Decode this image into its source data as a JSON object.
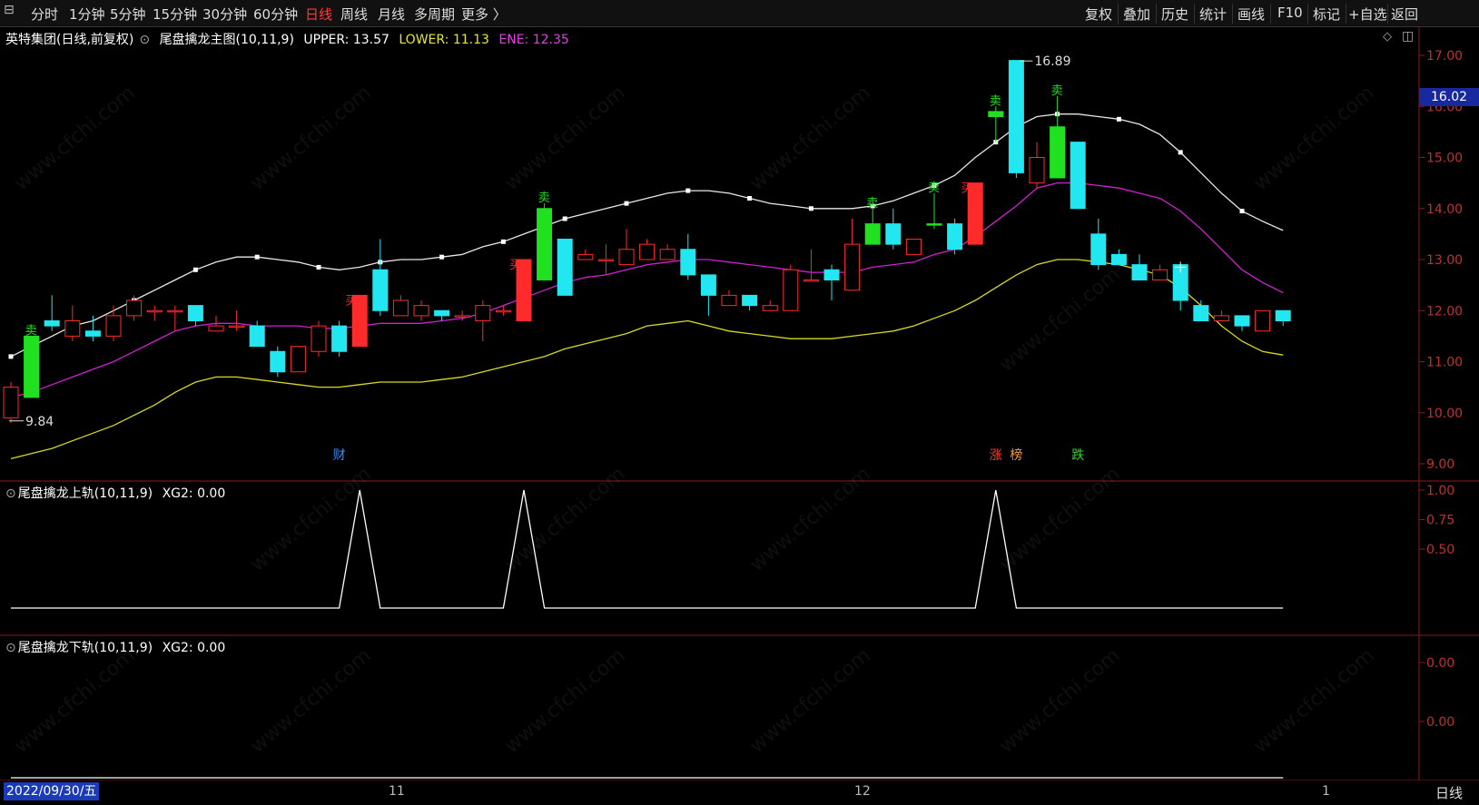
{
  "toolbar": {
    "tabs": [
      "分时",
      "1分钟",
      "5分钟",
      "15分钟",
      "30分钟",
      "60分钟",
      "日线",
      "周线",
      "月线",
      "多周期",
      "更多 〉"
    ],
    "active_tab": "日线",
    "right_buttons": [
      "复权",
      "叠加",
      "历史",
      "统计",
      "画线",
      "F10",
      "标记",
      "+自选",
      "返回"
    ]
  },
  "main_legend": {
    "stock": "英特集团(日线,前复权)",
    "indicator": "尾盘擒龙主图(10,11,9)",
    "upper": "UPPER: 13.57",
    "lower": "LOWER: 11.13",
    "ene": "ENE: 12.35"
  },
  "sub1_legend": {
    "name": "尾盘擒龙上轨(10,11,9)",
    "value": "XG2: 0.00"
  },
  "sub2_legend": {
    "name": "尾盘擒龙下轨(10,11,9)",
    "value": "XG2: 0.00"
  },
  "price_axis": [
    "17.00",
    "16.00",
    "15.00",
    "14.00",
    "13.00",
    "12.00",
    "11.00",
    "10.00",
    "9.00"
  ],
  "current_price": "16.02",
  "sub1_axis": [
    "1.00",
    "0.75",
    "0.50"
  ],
  "sub2_axis": [
    "0.00",
    "0.00"
  ],
  "annotations": {
    "high": "16.89",
    "low": "9.84"
  },
  "events": {
    "cai": "财",
    "zhang": "涨",
    "bang": "榜",
    "die": "跌"
  },
  "signals": {
    "buy": "买",
    "sell": "卖"
  },
  "x_labels": {
    "nov": "11",
    "dec": "12",
    "jan": "1"
  },
  "date_chip": "2022/09/30/五",
  "period": "日线",
  "watermark": "www.cfchi.com",
  "colors": {
    "up": "#ff2a2a",
    "down": "#22e6f0",
    "bull_signal": "#20e020",
    "upper": "#e8e8e8",
    "ene": "#d020d0",
    "lower": "#d8d820"
  },
  "chart_data": {
    "type": "candlestick",
    "ylim": [
      9.0,
      17.2
    ],
    "candles": [
      {
        "o": 9.9,
        "h": 10.6,
        "l": 9.8,
        "c": 10.5
      },
      {
        "o": 11.5,
        "h": 11.5,
        "l": 10.3,
        "c": 10.3,
        "sig": "bull"
      },
      {
        "o": 11.8,
        "h": 12.3,
        "l": 11.6,
        "c": 11.7
      },
      {
        "o": 11.5,
        "h": 12.1,
        "l": 11.4,
        "c": 11.8
      },
      {
        "o": 11.6,
        "h": 11.9,
        "l": 11.4,
        "c": 11.5
      },
      {
        "o": 11.5,
        "h": 12.1,
        "l": 11.4,
        "c": 11.9
      },
      {
        "o": 11.9,
        "h": 12.3,
        "l": 11.8,
        "c": 12.2
      },
      {
        "o": 12.0,
        "h": 12.1,
        "l": 11.8,
        "c": 12.0
      },
      {
        "o": 12.0,
        "h": 12.1,
        "l": 11.6,
        "c": 12.0
      },
      {
        "o": 12.1,
        "h": 12.1,
        "l": 11.7,
        "c": 11.8
      },
      {
        "o": 11.6,
        "h": 11.9,
        "l": 11.6,
        "c": 11.7
      },
      {
        "o": 11.7,
        "h": 12.0,
        "l": 11.6,
        "c": 11.7
      },
      {
        "o": 11.7,
        "h": 11.8,
        "l": 11.3,
        "c": 11.3
      },
      {
        "o": 11.2,
        "h": 11.3,
        "l": 10.7,
        "c": 10.8
      },
      {
        "o": 10.8,
        "h": 11.3,
        "l": 10.8,
        "c": 11.3
      },
      {
        "o": 11.2,
        "h": 11.8,
        "l": 11.1,
        "c": 11.7
      },
      {
        "o": 11.7,
        "h": 11.8,
        "l": 11.1,
        "c": 11.2
      },
      {
        "o": 11.3,
        "h": 12.3,
        "l": 11.3,
        "c": 12.3,
        "sig": "buy"
      },
      {
        "o": 12.8,
        "h": 13.4,
        "l": 11.9,
        "c": 12.0
      },
      {
        "o": 11.9,
        "h": 12.3,
        "l": 11.9,
        "c": 12.2
      },
      {
        "o": 11.9,
        "h": 12.2,
        "l": 11.8,
        "c": 12.1
      },
      {
        "o": 12.0,
        "h": 12.0,
        "l": 11.8,
        "c": 11.9
      },
      {
        "o": 11.9,
        "h": 12.0,
        "l": 11.8,
        "c": 11.9
      },
      {
        "o": 11.8,
        "h": 12.2,
        "l": 11.4,
        "c": 12.1
      },
      {
        "o": 12.0,
        "h": 12.1,
        "l": 11.9,
        "c": 12.0
      },
      {
        "o": 11.8,
        "h": 13.0,
        "l": 11.8,
        "c": 13.0,
        "sig": "buy"
      },
      {
        "o": 14.0,
        "h": 14.1,
        "l": 12.6,
        "c": 12.6,
        "sig": "bull"
      },
      {
        "o": 13.4,
        "h": 13.4,
        "l": 12.3,
        "c": 12.3
      },
      {
        "o": 13.0,
        "h": 13.2,
        "l": 13.0,
        "c": 13.1
      },
      {
        "o": 13.0,
        "h": 13.3,
        "l": 12.7,
        "c": 13.0
      },
      {
        "o": 12.9,
        "h": 13.6,
        "l": 12.9,
        "c": 13.2
      },
      {
        "o": 13.0,
        "h": 13.4,
        "l": 13.0,
        "c": 13.3
      },
      {
        "o": 13.0,
        "h": 13.3,
        "l": 13.0,
        "c": 13.2
      },
      {
        "o": 13.2,
        "h": 13.5,
        "l": 12.6,
        "c": 12.7
      },
      {
        "o": 12.7,
        "h": 12.7,
        "l": 11.9,
        "c": 12.3
      },
      {
        "o": 12.1,
        "h": 12.4,
        "l": 12.1,
        "c": 12.3
      },
      {
        "o": 12.3,
        "h": 12.3,
        "l": 12.0,
        "c": 12.1
      },
      {
        "o": 12.0,
        "h": 12.2,
        "l": 12.0,
        "c": 12.1
      },
      {
        "o": 12.0,
        "h": 12.9,
        "l": 12.0,
        "c": 12.8
      },
      {
        "o": 12.6,
        "h": 13.2,
        "l": 12.6,
        "c": 12.6
      },
      {
        "o": 12.8,
        "h": 12.9,
        "l": 12.2,
        "c": 12.6
      },
      {
        "o": 12.4,
        "h": 13.8,
        "l": 12.4,
        "c": 13.3
      },
      {
        "o": 13.3,
        "h": 14.0,
        "l": 13.3,
        "c": 13.7,
        "sig": "bull"
      },
      {
        "o": 13.7,
        "h": 14.0,
        "l": 13.2,
        "c": 13.3
      },
      {
        "o": 13.1,
        "h": 13.4,
        "l": 13.1,
        "c": 13.4
      },
      {
        "o": 13.7,
        "h": 14.3,
        "l": 13.6,
        "c": 13.7,
        "sig": "bull"
      },
      {
        "o": 13.7,
        "h": 13.8,
        "l": 13.1,
        "c": 13.2
      },
      {
        "o": 13.3,
        "h": 14.5,
        "l": 13.3,
        "c": 14.5,
        "sig": "buy"
      },
      {
        "o": 15.8,
        "h": 16.0,
        "l": 15.3,
        "c": 15.9,
        "sig": "bull"
      },
      {
        "o": 16.9,
        "h": 16.9,
        "l": 14.6,
        "c": 14.7
      },
      {
        "o": 14.5,
        "h": 15.3,
        "l": 14.4,
        "c": 15.0
      },
      {
        "o": 14.6,
        "h": 16.2,
        "l": 14.6,
        "c": 15.6,
        "sig": "bull"
      },
      {
        "o": 15.3,
        "h": 15.3,
        "l": 14.0,
        "c": 14.0
      },
      {
        "o": 13.5,
        "h": 13.8,
        "l": 12.8,
        "c": 12.9
      },
      {
        "o": 13.1,
        "h": 13.2,
        "l": 12.9,
        "c": 12.9
      },
      {
        "o": 12.9,
        "h": 13.1,
        "l": 12.6,
        "c": 12.6
      },
      {
        "o": 12.6,
        "h": 12.9,
        "l": 12.6,
        "c": 12.8
      },
      {
        "o": 12.9,
        "h": 12.9,
        "l": 12.0,
        "c": 12.2
      },
      {
        "o": 12.1,
        "h": 12.2,
        "l": 11.8,
        "c": 11.8
      },
      {
        "o": 11.8,
        "h": 12.0,
        "l": 11.8,
        "c": 11.9
      },
      {
        "o": 11.9,
        "h": 11.9,
        "l": 11.6,
        "c": 11.7
      },
      {
        "o": 11.6,
        "h": 12.0,
        "l": 11.6,
        "c": 12.0
      },
      {
        "o": 12.0,
        "h": 12.0,
        "l": 11.7,
        "c": 11.8
      }
    ],
    "upper": [
      11.1,
      11.3,
      11.5,
      11.7,
      11.8,
      12.0,
      12.2,
      12.4,
      12.6,
      12.8,
      12.95,
      13.05,
      13.05,
      13.0,
      12.95,
      12.85,
      12.8,
      12.85,
      12.95,
      13.0,
      13.0,
      13.05,
      13.1,
      13.25,
      13.35,
      13.5,
      13.65,
      13.8,
      13.9,
      14.0,
      14.1,
      14.2,
      14.3,
      14.35,
      14.35,
      14.3,
      14.2,
      14.1,
      14.05,
      14.0,
      14.0,
      14.0,
      14.05,
      14.15,
      14.3,
      14.45,
      14.65,
      15.0,
      15.3,
      15.6,
      15.8,
      15.85,
      15.85,
      15.8,
      15.75,
      15.65,
      15.45,
      15.1,
      14.7,
      14.3,
      13.95,
      13.75,
      13.57
    ],
    "ene": [
      10.3,
      10.4,
      10.55,
      10.7,
      10.85,
      11.0,
      11.2,
      11.4,
      11.6,
      11.7,
      11.75,
      11.75,
      11.7,
      11.7,
      11.7,
      11.65,
      11.65,
      11.7,
      11.75,
      11.75,
      11.75,
      11.8,
      11.85,
      11.95,
      12.1,
      12.25,
      12.4,
      12.55,
      12.65,
      12.7,
      12.8,
      12.9,
      12.95,
      13.0,
      13.0,
      12.95,
      12.9,
      12.85,
      12.8,
      12.75,
      12.75,
      12.75,
      12.85,
      12.9,
      12.95,
      13.1,
      13.2,
      13.45,
      13.75,
      14.05,
      14.4,
      14.5,
      14.5,
      14.45,
      14.4,
      14.3,
      14.2,
      13.95,
      13.6,
      13.2,
      12.8,
      12.55,
      12.35
    ],
    "lower": [
      9.1,
      9.2,
      9.3,
      9.45,
      9.6,
      9.75,
      9.95,
      10.15,
      10.4,
      10.6,
      10.7,
      10.7,
      10.65,
      10.6,
      10.55,
      10.5,
      10.5,
      10.55,
      10.6,
      10.6,
      10.6,
      10.65,
      10.7,
      10.8,
      10.9,
      11.0,
      11.1,
      11.25,
      11.35,
      11.45,
      11.55,
      11.7,
      11.75,
      11.8,
      11.7,
      11.6,
      11.55,
      11.5,
      11.45,
      11.45,
      11.45,
      11.5,
      11.55,
      11.6,
      11.7,
      11.85,
      12.0,
      12.2,
      12.45,
      12.7,
      12.9,
      13.0,
      13.0,
      12.95,
      12.9,
      12.8,
      12.7,
      12.45,
      12.1,
      11.7,
      11.4,
      11.2,
      11.13
    ],
    "sub1_spikes": [
      17,
      25,
      48
    ],
    "sub1_ylim": [
      0,
      1.1
    ],
    "sub2_ylim": [
      0,
      1
    ]
  }
}
